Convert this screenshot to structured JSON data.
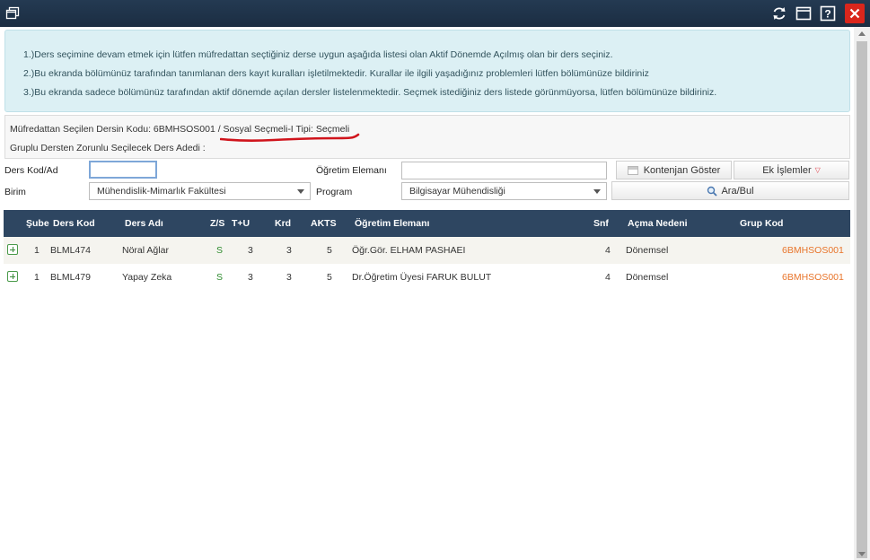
{
  "window": {
    "icons": [
      "restore-window-icon",
      "refresh-icon",
      "maximize-icon",
      "help-icon",
      "close-icon"
    ],
    "close_color": "#d9261c"
  },
  "info": {
    "line1": "1.)Ders seçimine devam etmek için lütfen müfredattan seçtiğiniz derse uygun aşağıda listesi olan Aktif Dönemde Açılmış olan bir ders seçiniz.",
    "line2": "2.)Bu ekranda bölümünüz tarafından tanımlanan ders kayıt kuralları işletilmektedir. Kurallar ile ilgili yaşadığınız problemleri lütfen bölümünüze bildiriniz",
    "line3": "3.)Bu ekranda sadece bölümünüz tarafından aktif dönemde açılan dersler listelenmektedir. Seçmek istediğiniz ders listede görünmüyorsa, lütfen bölümünüze bildiriniz."
  },
  "selection": {
    "line1": "Müfredattan Seçilen Dersin Kodu: 6BMHSOS001 / Sosyal Seçmeli-I Tipi: Seçmeli",
    "line2": "Gruplu Dersten Zorunlu Seçilecek Ders Adedi :"
  },
  "form": {
    "ders_kod_label": "Ders Kod/Ad",
    "ders_kod_value": "",
    "ogretim_label": "Öğretim Elemanı",
    "ogretim_value": "",
    "kontenjan_button": "Kontenjan Göster",
    "ek_islemler_button": "Ek İşlemler",
    "birim_label": "Birim",
    "birim_value": "Mühendislik-Mimarlık Fakültesi",
    "program_label": "Program",
    "program_value": "Bilgisayar Mühendisliği",
    "search_button": "Ara/Bul"
  },
  "table": {
    "headers": [
      "Şube",
      "Ders Kod",
      "Ders Adı",
      "Z/S",
      "T+U",
      "Krd",
      "AKTS",
      "Öğretim Elemanı",
      "Snf",
      "Açma Nedeni",
      "Grup Kod"
    ],
    "rows": [
      {
        "sube": "1",
        "kod": "BLML474",
        "ad": "Nöral Ağlar",
        "zs": "S",
        "tu": "3",
        "krd": "3",
        "akts": "5",
        "ogretim": "Öğr.Gör. ELHAM PASHAEI",
        "snf": "4",
        "acma": "Dönemsel",
        "grup": "6BMHSOS001"
      },
      {
        "sube": "1",
        "kod": "BLML479",
        "ad": "Yapay Zeka",
        "zs": "S",
        "tu": "3",
        "krd": "3",
        "akts": "5",
        "ogretim": "Dr.Öğretim Üyesi FARUK BULUT",
        "snf": "4",
        "acma": "Dönemsel",
        "grup": "6BMHSOS001"
      }
    ]
  },
  "colors": {
    "header_bg": "#2e4661",
    "info_bg": "#dcf0f4",
    "group_code": "#e8742a",
    "zs_green": "#2e8b2e",
    "annotation_underline": "#d0141c"
  }
}
